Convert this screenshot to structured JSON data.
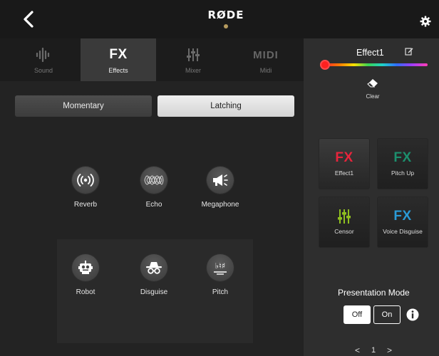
{
  "header": {
    "logo_text": "RØDE",
    "back_icon": "chevron-left-icon",
    "settings_icon": "gear-icon"
  },
  "tabs": [
    {
      "label": "Sound",
      "icon": "waveform-icon",
      "active": false
    },
    {
      "label": "Effects",
      "icon_text": "FX",
      "active": true
    },
    {
      "label": "Mixer",
      "icon": "faders-icon",
      "active": false
    },
    {
      "label": "Midi",
      "icon_text": "MIDI",
      "active": false
    }
  ],
  "mode": {
    "momentary_label": "Momentary",
    "latching_label": "Latching",
    "selected": "Latching"
  },
  "effects": [
    {
      "label": "Reverb",
      "icon": "reverb-icon"
    },
    {
      "label": "Echo",
      "icon": "echo-icon"
    },
    {
      "label": "Megaphone",
      "icon": "megaphone-icon"
    },
    {
      "label": "Robot",
      "icon": "robot-icon"
    },
    {
      "label": "Disguise",
      "icon": "disguise-icon"
    },
    {
      "label": "Pitch",
      "icon": "pitch-icon",
      "glyph": "♭♮♯"
    }
  ],
  "sidebar": {
    "selected_name": "Effect1",
    "color_slider_value": 0,
    "clear_label": "Clear",
    "pads": [
      {
        "glyph": "FX",
        "label": "Effect1",
        "color": "#e8243c"
      },
      {
        "glyph": "FX",
        "label": "Pitch Up",
        "color": "#1c8f6d"
      },
      {
        "glyph_icon": "faders-icon",
        "label": "Censor",
        "color": "#8fbf1f"
      },
      {
        "glyph": "FX",
        "label": "Voice Disguise",
        "color": "#2a9ad6"
      }
    ],
    "presentation_label": "Presentation Mode",
    "off_label": "Off",
    "on_label": "On",
    "presentation_value": "Off",
    "page_number": "1",
    "prev_arrow": "<",
    "next_arrow": ">"
  }
}
